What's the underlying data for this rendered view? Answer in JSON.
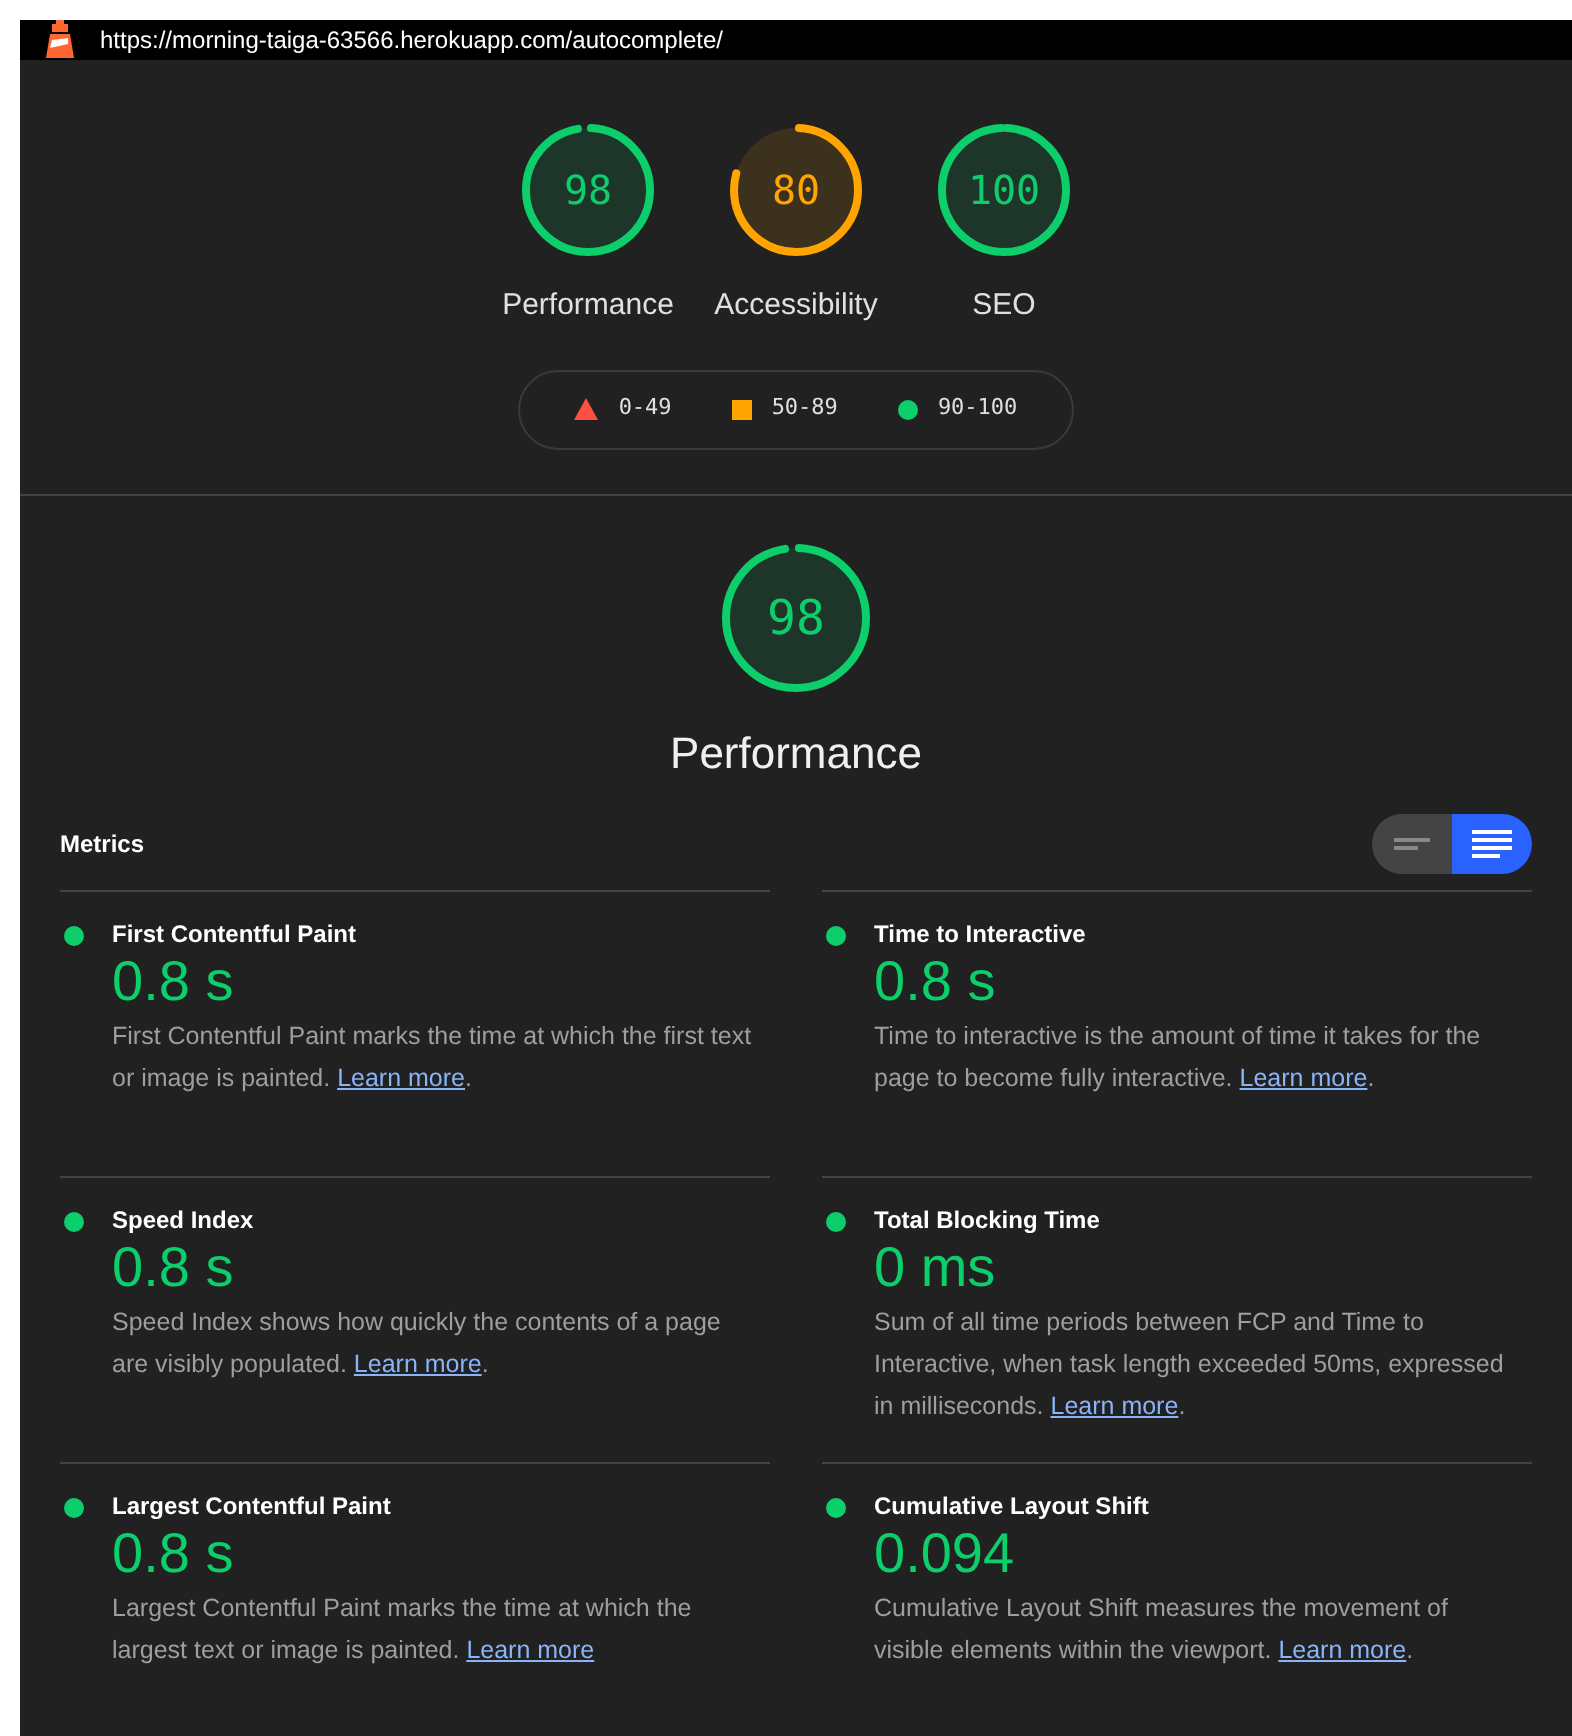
{
  "url_bar": {
    "url": "https://morning-taiga-63566.herokuapp.com/autocomplete/"
  },
  "gauges": [
    {
      "score": "98",
      "label": "Performance",
      "color": "#0cce6b"
    },
    {
      "score": "80",
      "label": "Accessibility",
      "color": "#ffa400"
    },
    {
      "score": "100",
      "label": "SEO",
      "color": "#0cce6b"
    }
  ],
  "legend": [
    {
      "range": "0-49",
      "kind": "fail"
    },
    {
      "range": "50-89",
      "kind": "average"
    },
    {
      "range": "90-100",
      "kind": "pass"
    }
  ],
  "category": {
    "score": "98",
    "title": "Performance",
    "color": "#0cce6b"
  },
  "metrics": {
    "heading": "Metrics",
    "view_toggle": [
      {
        "kind": "compact",
        "selected": false
      },
      {
        "kind": "expanded",
        "selected": true
      }
    ],
    "items": [
      {
        "title": "First Contentful Paint",
        "value": "0.8 s",
        "color": "#0cce6b",
        "description": "First Contentful Paint marks the time at which the first text or image is painted.",
        "link": "Learn more",
        "after": "."
      },
      {
        "title": "Time to Interactive",
        "value": "0.8 s",
        "color": "#0cce6b",
        "description": "Time to interactive is the amount of time it takes for the page to become fully interactive.",
        "link": "Learn more",
        "after": "."
      },
      {
        "title": "Speed Index",
        "value": "0.8 s",
        "color": "#0cce6b",
        "description": "Speed Index shows how quickly the contents of a page are visibly populated.",
        "link": "Learn more",
        "after": "."
      },
      {
        "title": "Total Blocking Time",
        "value": "0 ms",
        "color": "#0cce6b",
        "description": "Sum of all time periods between FCP and Time to Interactive, when task length exceeded 50ms, expressed in milliseconds.",
        "link": "Learn more",
        "after": "."
      },
      {
        "title": "Largest Contentful Paint",
        "value": "0.8 s",
        "color": "#0cce6b",
        "description": "Largest Contentful Paint marks the time at which the largest text or image is painted.",
        "link": "Learn more"
      },
      {
        "title": "Cumulative Layout Shift",
        "value": "0.094",
        "color": "#0cce6b",
        "description": "Cumulative Layout Shift measures the movement of visible elements within the viewport.",
        "link": "Learn more",
        "after": "."
      }
    ]
  }
}
